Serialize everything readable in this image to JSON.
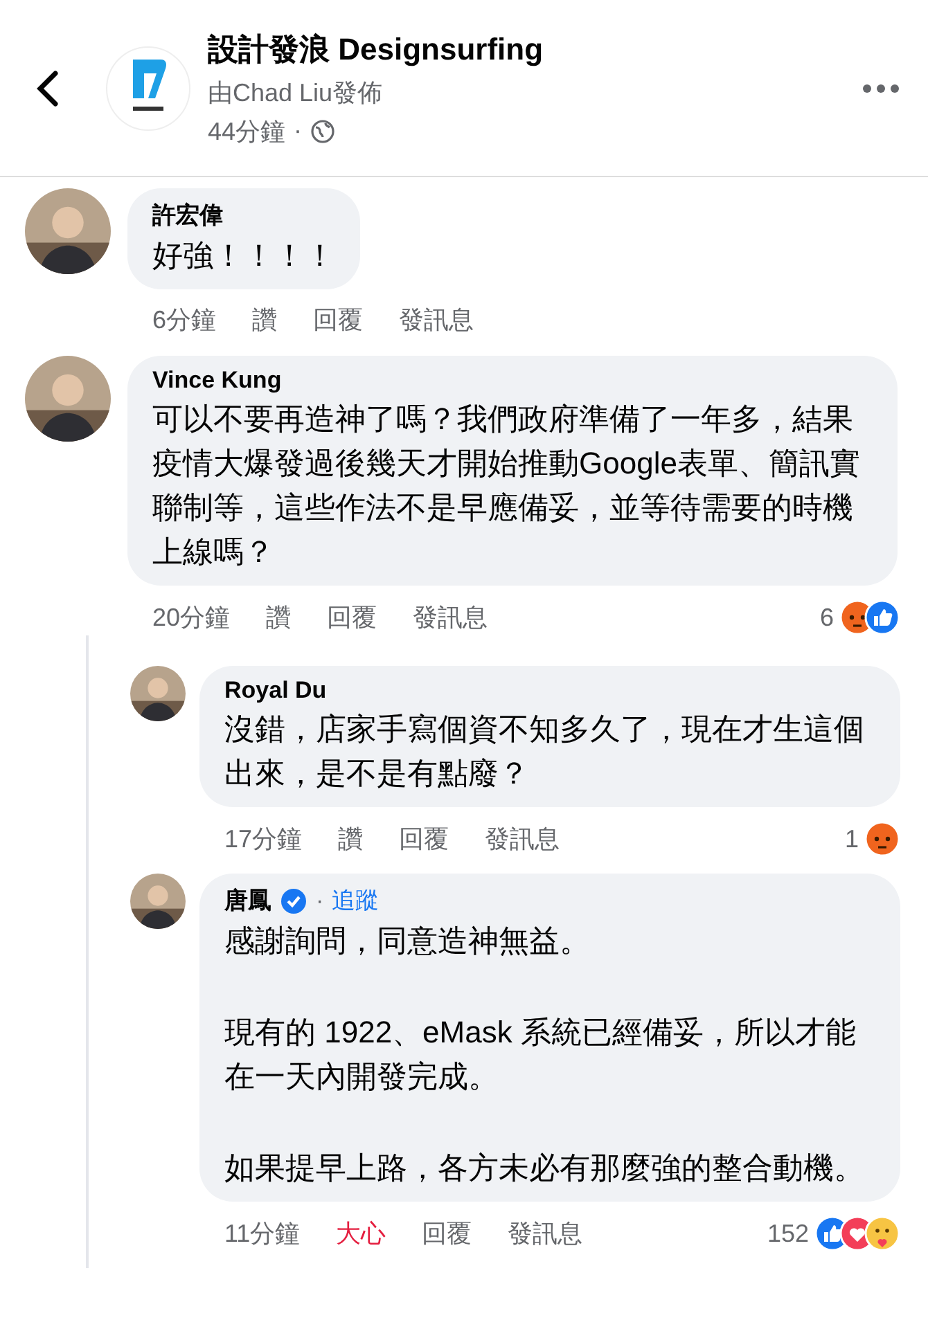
{
  "header": {
    "page_name": "設計發浪 Designsurfing",
    "byline": "由Chad Liu發佈",
    "time": "44分鐘",
    "separator": "·"
  },
  "comments": [
    {
      "author": "許宏偉",
      "paragraphs": [
        "好強！！！！"
      ],
      "time": "6分鐘",
      "like": {
        "label": "讚",
        "selected": false
      },
      "reply": "回覆",
      "message": "發訊息"
    },
    {
      "author": "Vince Kung",
      "paragraphs": [
        "可以不要再造神了嗎？我們政府準備了一年多，結果疫情大爆發過後幾天才開始推動Google表單、簡訊實聯制等，這些作法不是早應備妥，並等待需要的時機上線嗎？"
      ],
      "time": "20分鐘",
      "like": {
        "label": "讚",
        "selected": false
      },
      "reply": "回覆",
      "message": "發訊息",
      "reactions": {
        "count": "6",
        "icons": [
          {
            "kind": "angry"
          },
          {
            "kind": "like"
          }
        ]
      },
      "children": [
        {
          "author": "Royal Du",
          "paragraphs": [
            "沒錯，店家手寫個資不知多久了，現在才生這個出來，是不是有點廢？"
          ],
          "time": "17分鐘",
          "like": {
            "label": "讚",
            "selected": false
          },
          "reply": "回覆",
          "message": "發訊息",
          "reactions": {
            "count": "1",
            "icons": [
              {
                "kind": "angry"
              }
            ]
          }
        },
        {
          "author": "唐鳳",
          "verified": true,
          "separator": "·",
          "follow": "追蹤",
          "paragraphs": [
            "感謝詢問，同意造神無益。",
            "現有的 1922、eMask 系統已經備妥，所以才能在一天內開發完成。",
            "如果提早上路，各方未必有那麼強的整合動機。"
          ],
          "time": "11分鐘",
          "like": {
            "label": "大心",
            "selected": true
          },
          "reply": "回覆",
          "message": "發訊息",
          "reactions": {
            "count": "152",
            "icons": [
              {
                "kind": "like"
              },
              {
                "kind": "love"
              },
              {
                "kind": "care"
              }
            ]
          }
        }
      ]
    }
  ]
}
